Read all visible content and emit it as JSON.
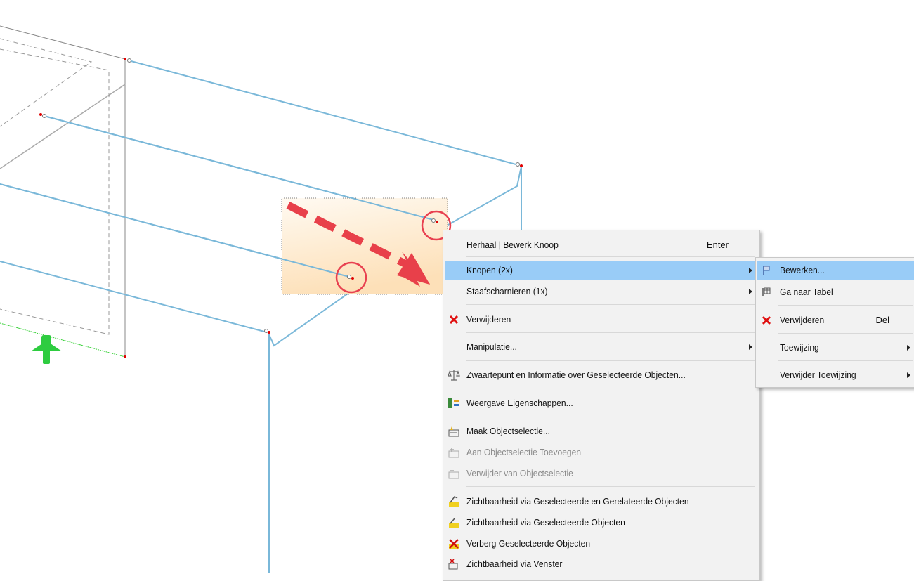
{
  "context_menu": {
    "items": [
      {
        "label": "Herhaal | Bewerk Knoop",
        "shortcut": "Enter",
        "icon": "none"
      },
      {
        "label": "Knopen (2x)",
        "submenu": true,
        "highlighted": true,
        "icon": "none"
      },
      {
        "label": "Staafscharnieren (1x)",
        "submenu": true,
        "icon": "none"
      },
      {
        "label": "Verwijderen",
        "icon": "red-x-icon"
      },
      {
        "label": "Manipulatie...",
        "submenu": true,
        "icon": "none"
      },
      {
        "label": "Zwaartepunt en Informatie over Geselecteerde Objecten...",
        "icon": "balance-scale-icon"
      },
      {
        "label": "Weergave Eigenschappen...",
        "icon": "display-properties-icon"
      },
      {
        "label": "Maak Objectselectie...",
        "icon": "create-selection-icon"
      },
      {
        "label": "Aan Objectselectie Toevoegen",
        "disabled": true,
        "icon": "add-selection-icon"
      },
      {
        "label": "Verwijder van Objectselectie",
        "disabled": true,
        "icon": "remove-selection-icon"
      },
      {
        "label": "Zichtbaarheid via Geselecteerde en Gerelateerde Objecten",
        "icon": "visibility-related-icon"
      },
      {
        "label": "Zichtbaarheid via Geselecteerde Objecten",
        "icon": "visibility-selected-icon"
      },
      {
        "label": "Verberg Geselecteerde Objecten",
        "icon": "hide-selected-icon"
      },
      {
        "label": "Zichtbaarheid via Venster",
        "icon": "visibility-window-icon"
      }
    ]
  },
  "submenu": {
    "items": [
      {
        "label": "Bewerken...",
        "highlighted": true,
        "icon": "edit-node-icon"
      },
      {
        "label": "Ga naar Tabel",
        "icon": "table-icon"
      },
      {
        "label": "Verwijderen",
        "shortcut": "Del",
        "icon": "red-x-icon"
      },
      {
        "label": "Toewijzing",
        "submenu": true,
        "icon": "none"
      },
      {
        "label": "Verwijder Toewijzing",
        "submenu": true,
        "icon": "none"
      }
    ]
  },
  "colors": {
    "member_line": "#7ab8d9",
    "node_red": "#e00000",
    "support_green": "#2ecc40",
    "highlight": "#99ccf7",
    "arrow_red": "#e8404a",
    "circle_red": "#e84050"
  }
}
